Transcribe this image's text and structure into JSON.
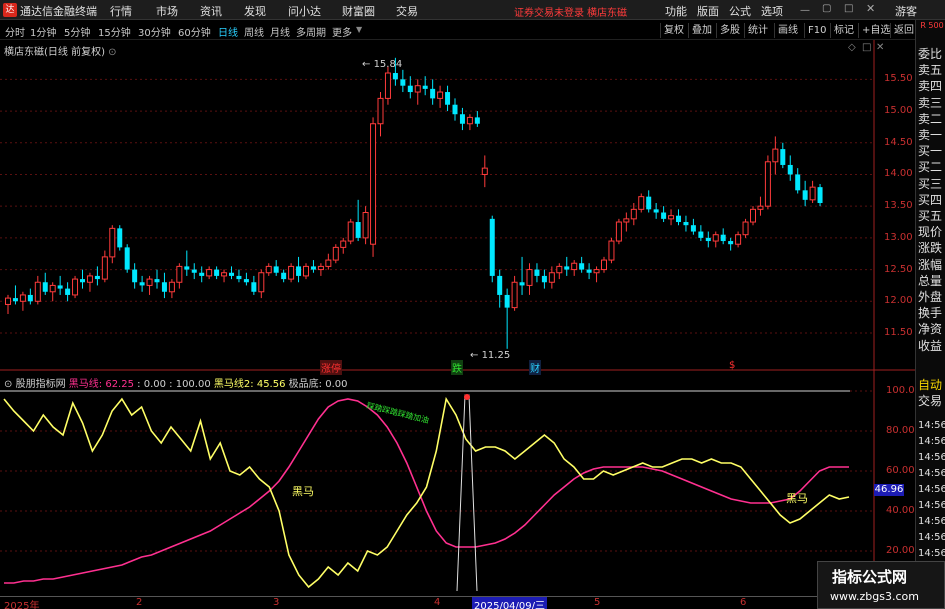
{
  "app": {
    "logo_char": "达",
    "title": "通达信金融终端",
    "menus": [
      "行情",
      "市场",
      "资讯",
      "发现",
      "问小达",
      "财富圈",
      "交易"
    ],
    "login_status": "证券交易未登录",
    "stock_name": "横店东磁",
    "right_menus": [
      "功能",
      "版面",
      "公式",
      "选项"
    ],
    "guest": "游客"
  },
  "periods": {
    "items": [
      "分时",
      "1分钟",
      "5分钟",
      "15分钟",
      "30分钟",
      "60分钟",
      "日线",
      "周线",
      "月线",
      "多周期",
      "更多"
    ],
    "active": "日线"
  },
  "toolbar": [
    "复权",
    "叠加",
    "多股",
    "统计",
    "画线",
    "F10",
    "标记",
    "+自选",
    "返回"
  ],
  "main_chart": {
    "title": "横店东磁(日线 前复权)",
    "high_label": "15.84",
    "low_label": "11.25",
    "y_ticks": [
      "15.50",
      "15.00",
      "14.50",
      "14.00",
      "13.50",
      "13.00",
      "12.50",
      "12.00",
      "11.50"
    ],
    "markers": [
      {
        "text": "涨停",
        "color": "#ff3030"
      },
      {
        "text": "跌",
        "color": "#30e030"
      },
      {
        "text": "财",
        "color": "#2ad0ff"
      },
      {
        "text": "$",
        "color": "#ff3030"
      }
    ]
  },
  "right_panel": {
    "top": "R 500",
    "items": [
      "委比",
      "卖五",
      "卖四",
      "卖三",
      "卖二",
      "卖一",
      "买一",
      "买二",
      "买三",
      "买四",
      "买五",
      "现价",
      "涨跌",
      "涨幅",
      "总量",
      "外盘",
      "换手",
      "净资",
      "收益"
    ],
    "lower_items": [
      "自动",
      "交易"
    ],
    "times": [
      "14:56",
      "14:56",
      "14:56",
      "14:56",
      "14:56",
      "14:56",
      "14:56",
      "14:56",
      "14:56",
      "14:56",
      "14:56"
    ]
  },
  "indicator": {
    "name": "股朋指标网",
    "line1_label": "黑马线",
    "line1_value": "62.25",
    "params": "0.00 : 100.00",
    "line2_label": "黑马线2",
    "line2_value": "45.56",
    "extra_label": "极品底",
    "extra_value": "0.00",
    "y_ticks": [
      "100.00",
      "80.00",
      "60.00",
      "40.00",
      "20.00"
    ],
    "value_box": "46.96",
    "annotations": [
      "黑马",
      "黑马"
    ],
    "green_text": "踩踏踩踏踩踏加油"
  },
  "x_axis": {
    "labels": [
      "2025年",
      "2",
      "3",
      "4",
      "5",
      "6"
    ],
    "current_date": "2025/04/09/三"
  },
  "watermark": {
    "line1": "指标公式网",
    "line2": "www.zbgs3.com"
  },
  "chart_data": [
    {
      "type": "candlestick",
      "title": "横店东磁(日线 前复权)",
      "ylim": [
        11.2,
        15.9
      ],
      "candles": [
        [
          11.95,
          12.1,
          11.8,
          12.05
        ],
        [
          12.05,
          12.25,
          11.95,
          12.0
        ],
        [
          12.0,
          12.15,
          11.85,
          12.1
        ],
        [
          12.1,
          12.2,
          11.95,
          12.0
        ],
        [
          12.0,
          12.4,
          11.95,
          12.3
        ],
        [
          12.3,
          12.45,
          12.1,
          12.15
        ],
        [
          12.15,
          12.3,
          12.0,
          12.25
        ],
        [
          12.25,
          12.4,
          12.1,
          12.2
        ],
        [
          12.2,
          12.3,
          12.0,
          12.1
        ],
        [
          12.1,
          12.4,
          12.05,
          12.35
        ],
        [
          12.35,
          12.5,
          12.2,
          12.3
        ],
        [
          12.3,
          12.45,
          12.15,
          12.4
        ],
        [
          12.4,
          12.55,
          12.25,
          12.35
        ],
        [
          12.35,
          12.8,
          12.3,
          12.7
        ],
        [
          12.7,
          13.2,
          12.6,
          13.15
        ],
        [
          13.15,
          13.2,
          12.8,
          12.85
        ],
        [
          12.85,
          12.9,
          12.45,
          12.5
        ],
        [
          12.5,
          12.6,
          12.2,
          12.3
        ],
        [
          12.3,
          12.4,
          12.15,
          12.25
        ],
        [
          12.25,
          12.4,
          12.1,
          12.35
        ],
        [
          12.35,
          12.5,
          12.2,
          12.3
        ],
        [
          12.3,
          12.45,
          12.05,
          12.15
        ],
        [
          12.15,
          12.35,
          12.05,
          12.3
        ],
        [
          12.3,
          12.6,
          12.2,
          12.55
        ],
        [
          12.55,
          12.8,
          12.4,
          12.5
        ],
        [
          12.5,
          12.6,
          12.35,
          12.45
        ],
        [
          12.45,
          12.55,
          12.3,
          12.4
        ],
        [
          12.4,
          12.55,
          12.35,
          12.5
        ],
        [
          12.5,
          12.55,
          12.35,
          12.4
        ],
        [
          12.4,
          12.5,
          12.3,
          12.45
        ],
        [
          12.45,
          12.55,
          12.35,
          12.4
        ],
        [
          12.4,
          12.5,
          12.3,
          12.35
        ],
        [
          12.35,
          12.45,
          12.25,
          12.3
        ],
        [
          12.3,
          12.4,
          12.1,
          12.15
        ],
        [
          12.15,
          12.5,
          12.05,
          12.45
        ],
        [
          12.45,
          12.6,
          12.4,
          12.55
        ],
        [
          12.55,
          12.65,
          12.4,
          12.45
        ],
        [
          12.45,
          12.5,
          12.3,
          12.35
        ],
        [
          12.35,
          12.6,
          12.3,
          12.55
        ],
        [
          12.55,
          12.7,
          12.3,
          12.4
        ],
        [
          12.4,
          12.6,
          12.35,
          12.55
        ],
        [
          12.55,
          12.65,
          12.45,
          12.5
        ],
        [
          12.5,
          12.6,
          12.4,
          12.55
        ],
        [
          12.55,
          12.75,
          12.5,
          12.65
        ],
        [
          12.65,
          12.9,
          12.6,
          12.85
        ],
        [
          12.85,
          13.0,
          12.75,
          12.95
        ],
        [
          12.95,
          13.3,
          12.9,
          13.25
        ],
        [
          13.25,
          13.6,
          12.95,
          13.0
        ],
        [
          13.0,
          13.5,
          12.9,
          13.4
        ],
        [
          12.9,
          14.9,
          12.7,
          14.8
        ],
        [
          14.8,
          15.3,
          14.6,
          15.2
        ],
        [
          15.2,
          15.7,
          15.1,
          15.6
        ],
        [
          15.6,
          15.84,
          15.4,
          15.5
        ],
        [
          15.5,
          15.65,
          15.3,
          15.4
        ],
        [
          15.4,
          15.55,
          15.2,
          15.3
        ],
        [
          15.3,
          15.5,
          15.1,
          15.4
        ],
        [
          15.4,
          15.55,
          15.25,
          15.35
        ],
        [
          15.35,
          15.5,
          15.1,
          15.2
        ],
        [
          15.2,
          15.4,
          15.05,
          15.3
        ],
        [
          15.3,
          15.4,
          15.0,
          15.1
        ],
        [
          15.1,
          15.2,
          14.85,
          14.95
        ],
        [
          14.95,
          15.05,
          14.7,
          14.8
        ],
        [
          14.8,
          14.95,
          14.7,
          14.9
        ],
        [
          14.9,
          15.0,
          14.75,
          14.8
        ],
        [
          14.0,
          14.3,
          13.8,
          14.1
        ],
        [
          13.3,
          13.35,
          12.3,
          12.4
        ],
        [
          12.4,
          12.5,
          11.9,
          12.1
        ],
        [
          12.1,
          12.2,
          11.25,
          11.9
        ],
        [
          11.9,
          12.4,
          11.85,
          12.3
        ],
        [
          12.3,
          12.7,
          12.1,
          12.25
        ],
        [
          12.25,
          12.6,
          12.1,
          12.5
        ],
        [
          12.5,
          12.6,
          12.3,
          12.4
        ],
        [
          12.4,
          12.5,
          12.2,
          12.3
        ],
        [
          12.3,
          12.55,
          12.2,
          12.45
        ],
        [
          12.45,
          12.6,
          12.35,
          12.55
        ],
        [
          12.55,
          12.7,
          12.4,
          12.5
        ],
        [
          12.5,
          12.65,
          12.4,
          12.6
        ],
        [
          12.6,
          12.7,
          12.45,
          12.5
        ],
        [
          12.5,
          12.6,
          12.35,
          12.45
        ],
        [
          12.45,
          12.55,
          12.3,
          12.5
        ],
        [
          12.5,
          12.7,
          12.45,
          12.65
        ],
        [
          12.65,
          13.0,
          12.6,
          12.95
        ],
        [
          12.95,
          13.3,
          12.9,
          13.25
        ],
        [
          13.25,
          13.4,
          13.1,
          13.3
        ],
        [
          13.3,
          13.55,
          13.2,
          13.45
        ],
        [
          13.45,
          13.7,
          13.4,
          13.65
        ],
        [
          13.65,
          13.75,
          13.4,
          13.45
        ],
        [
          13.45,
          13.55,
          13.3,
          13.4
        ],
        [
          13.4,
          13.5,
          13.25,
          13.3
        ],
        [
          13.3,
          13.45,
          13.2,
          13.35
        ],
        [
          13.35,
          13.45,
          13.2,
          13.25
        ],
        [
          13.25,
          13.35,
          13.1,
          13.2
        ],
        [
          13.2,
          13.3,
          13.05,
          13.1
        ],
        [
          13.1,
          13.2,
          12.95,
          13.0
        ],
        [
          13.0,
          13.1,
          12.85,
          12.95
        ],
        [
          12.95,
          13.1,
          12.85,
          13.05
        ],
        [
          13.05,
          13.15,
          12.9,
          12.95
        ],
        [
          12.95,
          13.0,
          12.8,
          12.9
        ],
        [
          12.9,
          13.1,
          12.85,
          13.05
        ],
        [
          13.05,
          13.3,
          13.0,
          13.25
        ],
        [
          13.25,
          13.5,
          13.2,
          13.45
        ],
        [
          13.45,
          13.65,
          13.35,
          13.5
        ],
        [
          13.5,
          14.3,
          13.45,
          14.2
        ],
        [
          14.2,
          14.6,
          14.0,
          14.4
        ],
        [
          14.4,
          14.5,
          14.1,
          14.15
        ],
        [
          14.15,
          14.3,
          13.9,
          14.0
        ],
        [
          14.0,
          14.1,
          13.7,
          13.75
        ],
        [
          13.75,
          13.9,
          13.5,
          13.6
        ],
        [
          13.6,
          13.9,
          13.55,
          13.8
        ],
        [
          13.8,
          13.85,
          13.5,
          13.55
        ]
      ]
    },
    {
      "type": "line",
      "title": "股朋指标网",
      "ylim": [
        0,
        100
      ],
      "series": [
        {
          "name": "黑马线",
          "color": "#ff3090",
          "values": [
            4,
            4,
            5,
            5,
            6,
            6,
            7,
            8,
            9,
            10,
            11,
            12,
            13,
            15,
            17,
            18,
            20,
            22,
            24,
            26,
            28,
            30,
            33,
            36,
            39,
            42,
            46,
            50,
            55,
            62,
            70,
            78,
            86,
            92,
            95,
            96,
            95,
            92,
            88,
            82,
            74,
            64,
            52,
            40,
            30,
            24,
            22,
            22,
            22,
            23,
            24,
            26,
            29,
            33,
            38,
            43,
            48,
            52,
            56,
            59,
            61,
            62,
            62,
            62,
            62,
            62,
            61,
            60,
            58,
            56,
            54,
            52,
            50,
            48,
            46,
            45,
            44,
            44,
            44,
            45,
            46,
            50,
            55,
            60,
            62,
            62,
            62
          ]
        },
        {
          "name": "黑马线2",
          "color": "#ffff66",
          "values": [
            96,
            90,
            85,
            80,
            88,
            82,
            78,
            94,
            84,
            70,
            78,
            90,
            96,
            88,
            92,
            80,
            74,
            82,
            76,
            70,
            85,
            66,
            74,
            60,
            58,
            62,
            56,
            52,
            40,
            18,
            8,
            2,
            6,
            12,
            8,
            14,
            10,
            20,
            18,
            22,
            30,
            38,
            44,
            52,
            70,
            96,
            88,
            76,
            70,
            72,
            72,
            70,
            66,
            70,
            74,
            78,
            74,
            66,
            62,
            56,
            56,
            60,
            58,
            60,
            62,
            64,
            62,
            62,
            64,
            66,
            66,
            64,
            66,
            64,
            64,
            62,
            56,
            50,
            44,
            38,
            34,
            36,
            40,
            44,
            48,
            46,
            47
          ]
        }
      ]
    }
  ]
}
